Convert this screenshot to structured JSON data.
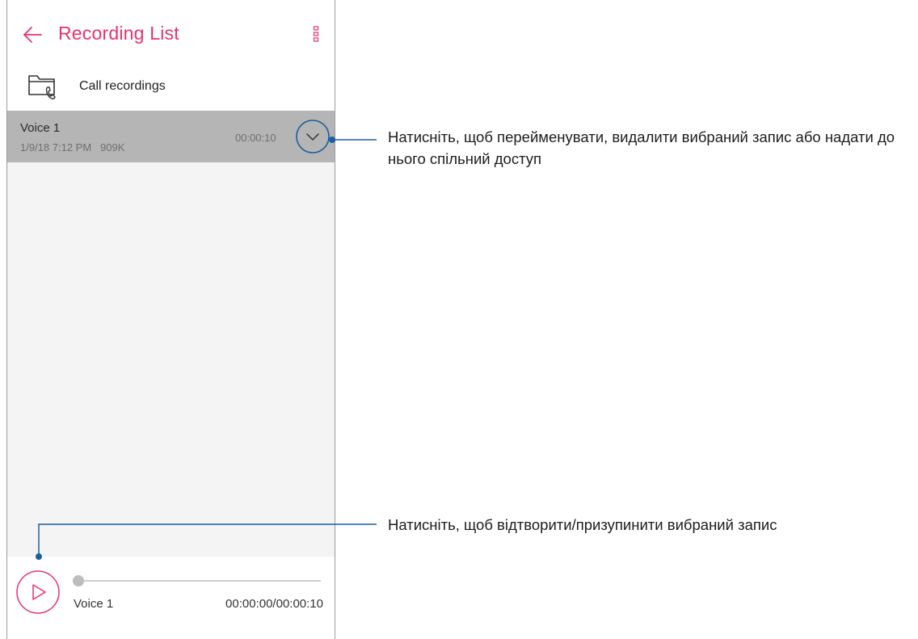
{
  "appbar": {
    "title": "Recording List",
    "accent_color": "#e8336b",
    "back_icon": "arrow-left-icon",
    "menu_icon": "more-vert-icon"
  },
  "folder": {
    "label": "Call recordings",
    "icon": "call-folder-icon"
  },
  "recordings": [
    {
      "name": "Voice 1",
      "meta": "1/9/18 7:12 PM   909K",
      "duration": "00:00:10",
      "selected": true,
      "expand_icon": "chevron-down-icon"
    }
  ],
  "player": {
    "name": "Voice 1",
    "time": "00:00:00/00:00:10",
    "progress": 0,
    "play_icon": "play-icon"
  },
  "annotations": {
    "line_color": "#1a5fa0",
    "rename_delete_share": "Натисніть, щоб перейменувати, видалити вибраний запис або надати до нього спільний доступ",
    "play_pause": "Натисніть, щоб відтворити/призупинити вибраний запис"
  }
}
